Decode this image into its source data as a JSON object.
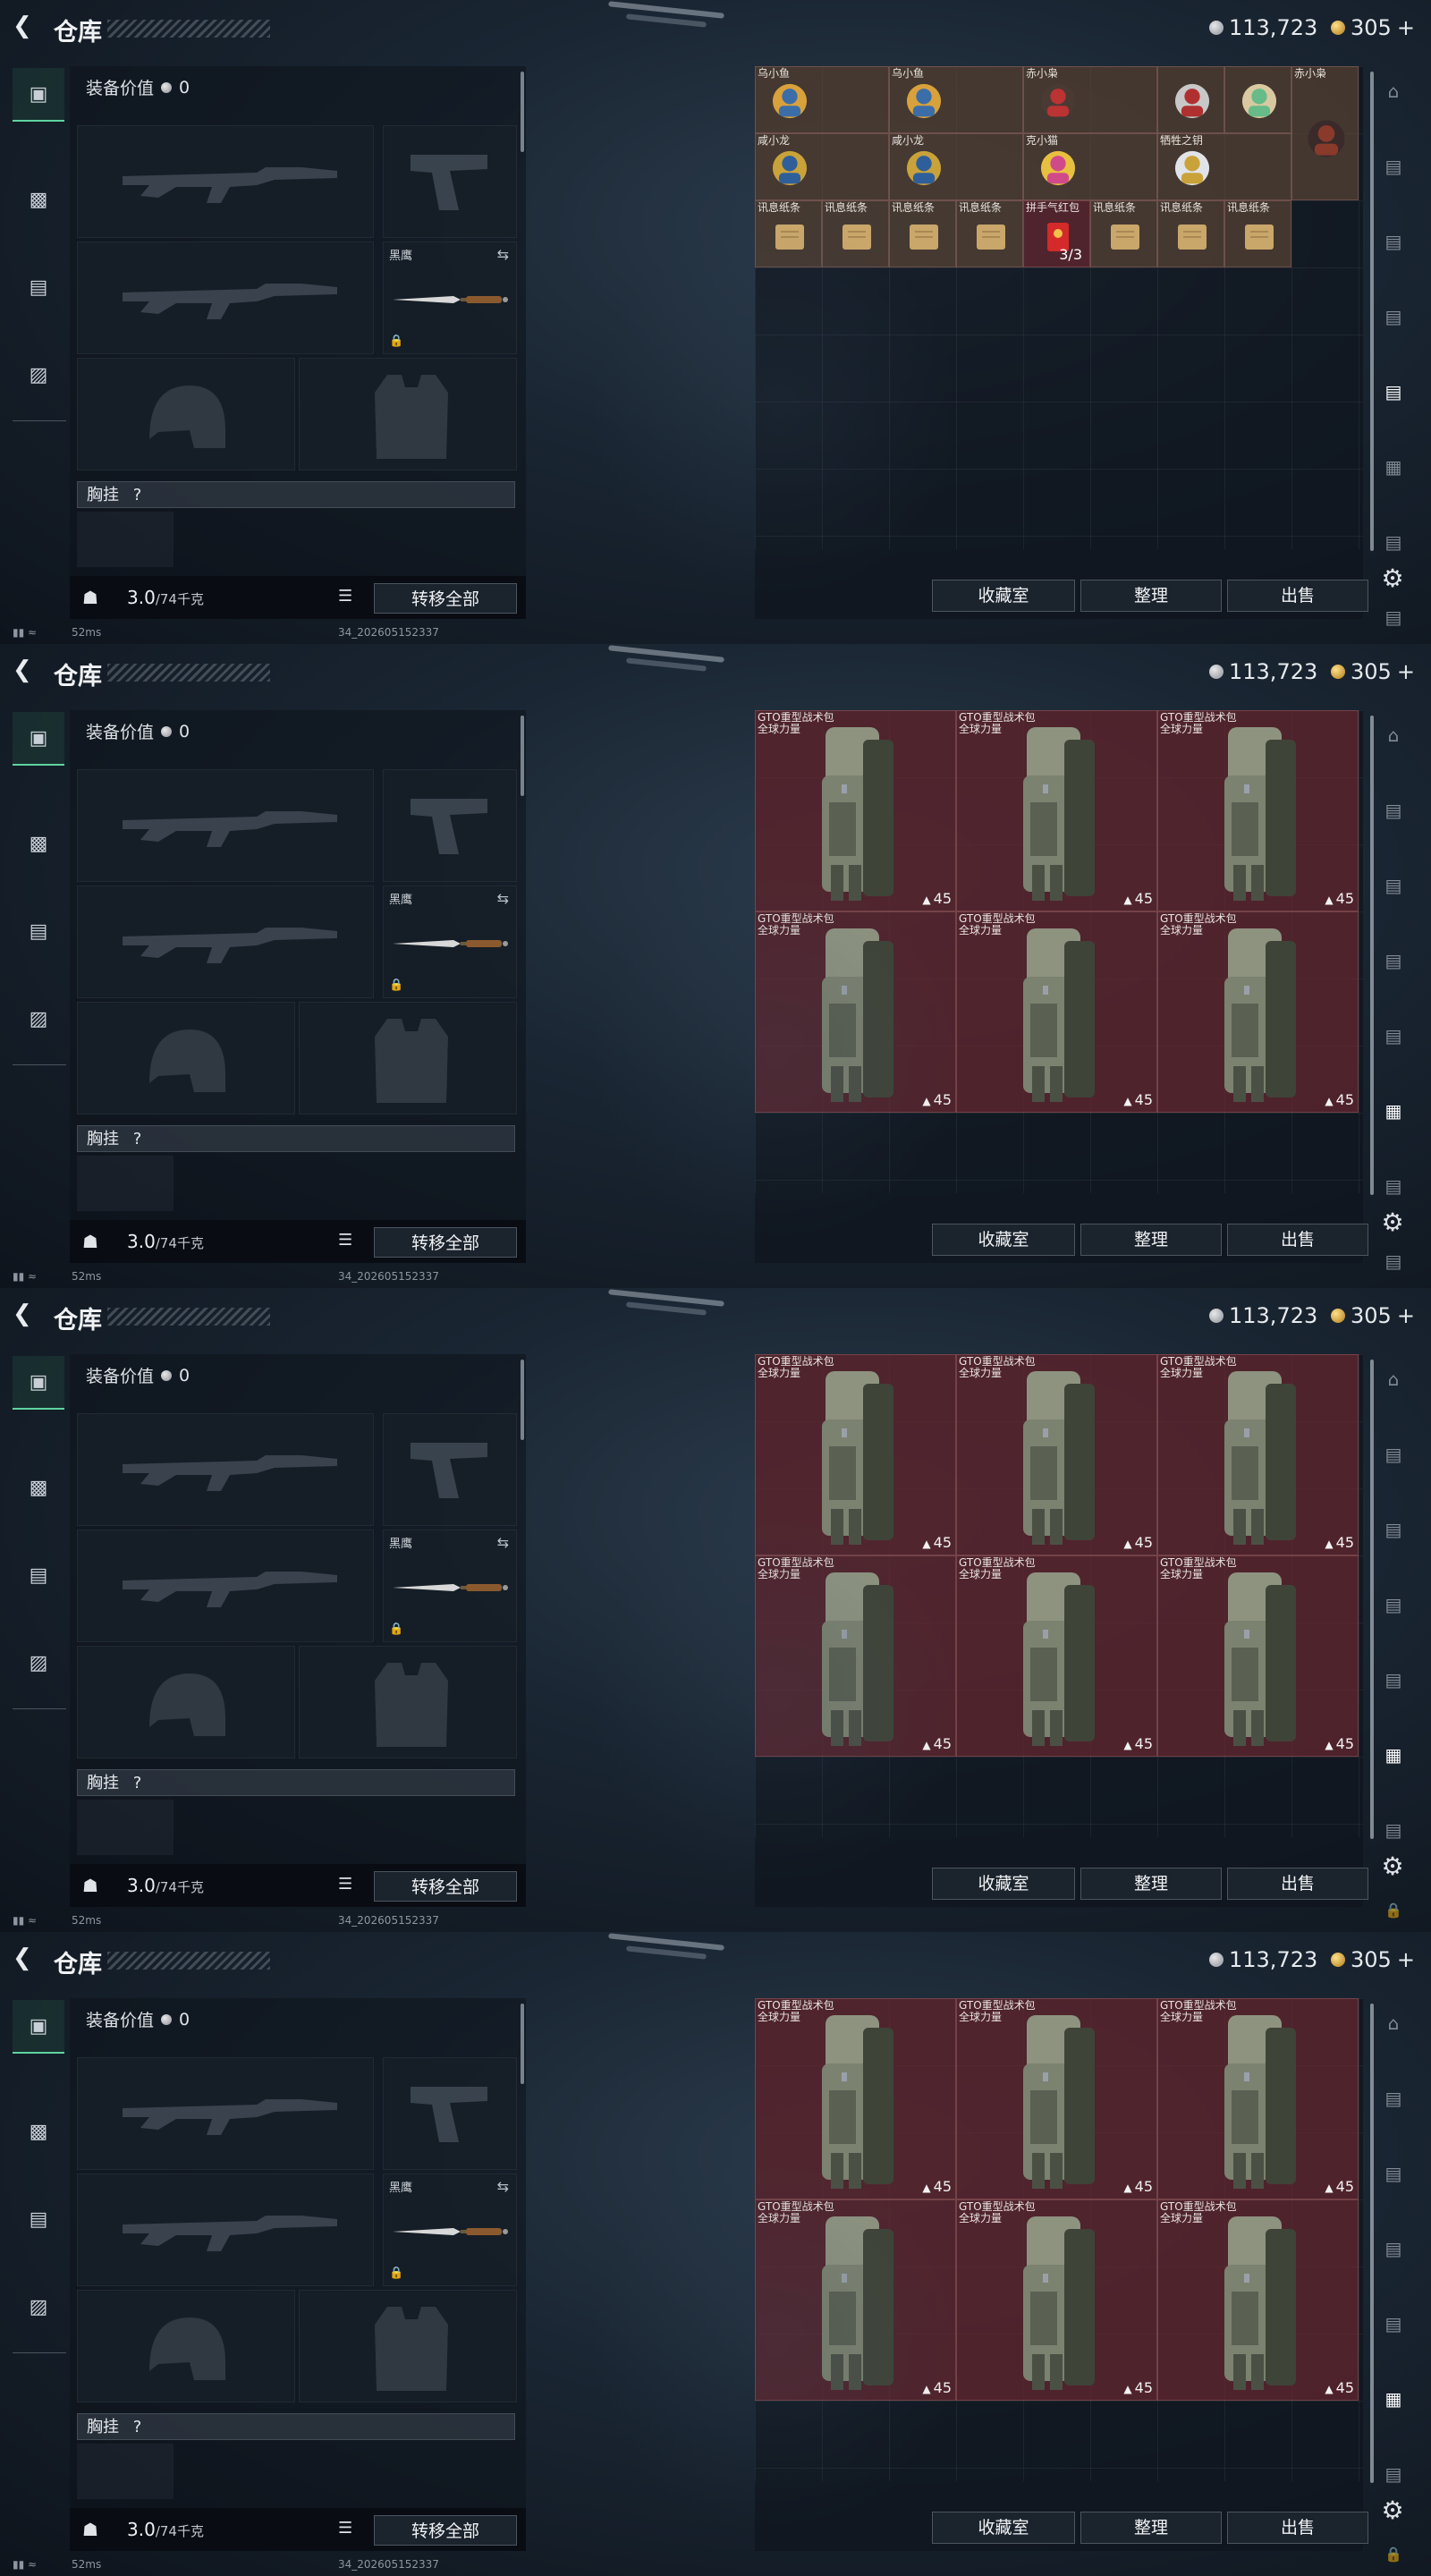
{
  "frames": [
    {
      "title": "仓库",
      "currency": {
        "silver": "113,723",
        "gold": "305"
      },
      "equip_value_label": "装备价值",
      "equip_value": "0",
      "knife_name": "黑鹰",
      "chest_label": "胸挂",
      "chest_hint": "?",
      "weight": "3.0",
      "weight_max": "/74千克",
      "transfer_all": "转移全部",
      "stash_buttons": [
        "收藏室",
        "整理",
        "出售"
      ],
      "status": {
        "ping": "52ms",
        "uid": "34_202605152337"
      },
      "stash_items": {
        "row1": [
          "乌小鱼",
          "乌小鱼",
          "赤小枭",
          "",
          "",
          "赤小枭"
        ],
        "row2": [
          "咸小龙",
          "咸小龙",
          "克小猫",
          "牺牲之钥"
        ],
        "row3": [
          "讯息纸条",
          "讯息纸条",
          "讯息纸条",
          "讯息纸条",
          "拼手气红包",
          "讯息纸条",
          "讯息纸条",
          "讯息纸条"
        ],
        "redpacket_count": "3/3"
      }
    },
    {
      "backpacks": [
        {
          "name": "GTO重型战术包",
          "sub": "全球力量",
          "dur": "45"
        },
        {
          "name": "GTO重型战术包",
          "sub": "全球力量",
          "dur": "45"
        },
        {
          "name": "GTO重型战术包",
          "sub": "全球力量",
          "dur": "45"
        },
        {
          "name": "GTO重型战术包",
          "sub": "全球力量",
          "dur": "45"
        },
        {
          "name": "GTO重型战术包",
          "sub": "全球力量",
          "dur": "45"
        },
        {
          "name": "GTO重型战术包",
          "sub": "全球力量",
          "dur": "45"
        }
      ]
    }
  ],
  "icons": {
    "back": "chevron-left-icon",
    "nav": [
      "gun-icon",
      "armor-icon",
      "backpack-icon",
      "briefcase-icon"
    ],
    "rail": [
      "helmet-icon",
      "tv-icon",
      "tv-icon",
      "tv-icon",
      "tv-icon",
      "safebox-icon",
      "tv-icon",
      "tv-icon"
    ],
    "settings": "gear-icon"
  },
  "colors": {
    "tan_cell": "#6e503a",
    "red_cell": "#692830",
    "nav_active": "#5ed3a0"
  }
}
